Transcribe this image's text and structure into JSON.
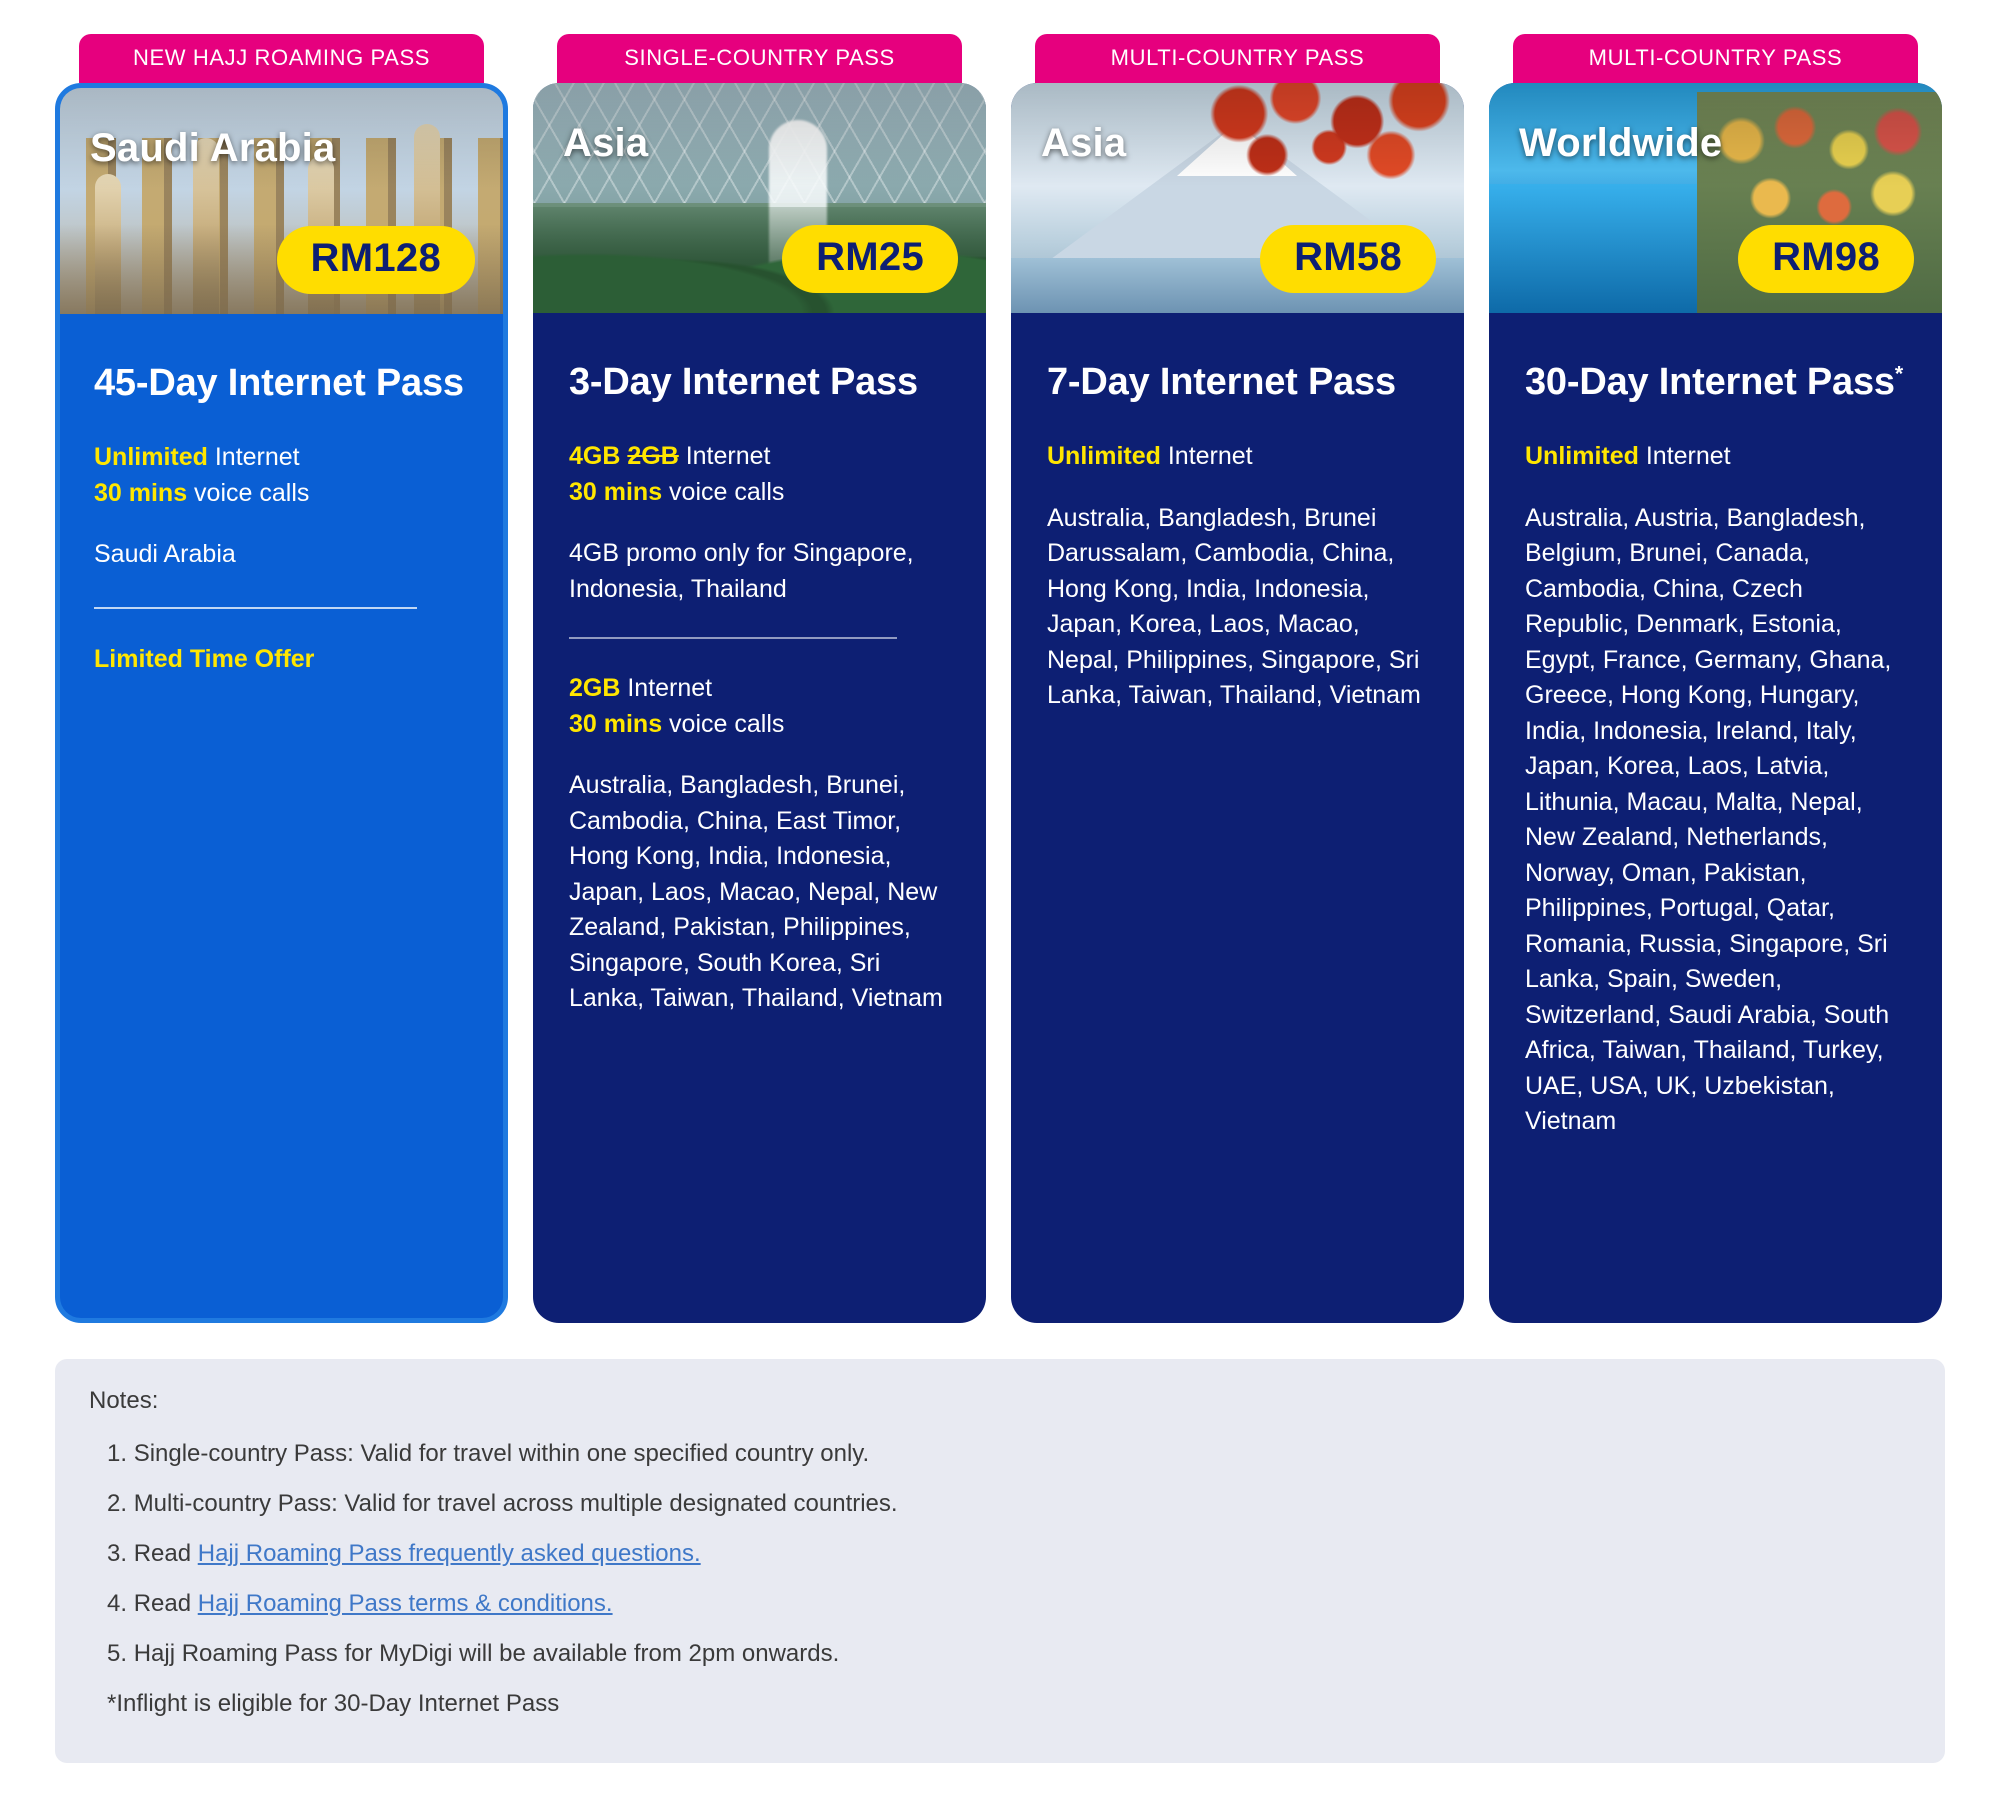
{
  "cards": [
    {
      "ribbon": "NEW HAJJ ROAMING PASS",
      "region": "Saudi Arabia",
      "price": "RM128",
      "plan_title": "45-Day Internet Pass",
      "spec_data_label": "Unlimited",
      "spec_data_rest": " Internet",
      "spec_voice_label": "30 mins",
      "spec_voice_rest": " voice calls",
      "countries": "Saudi Arabia",
      "offer": "Limited Time Offer",
      "art": "art-saudi"
    },
    {
      "ribbon": "SINGLE-COUNTRY PASS",
      "region": "Asia",
      "price": "RM25",
      "plan_title": "3-Day Internet Pass",
      "spec_data_label": "4GB",
      "spec_data_strike": "2GB",
      "spec_data_rest": " Internet",
      "spec_voice_label": "30 mins",
      "spec_voice_rest": " voice calls",
      "promo_note": "4GB promo only for Singapore, Indonesia, Thailand",
      "second_data_label": "2GB",
      "second_data_rest": " Internet",
      "second_voice_label": "30 mins",
      "second_voice_rest": " voice calls",
      "countries": "Australia, Bangladesh, Brunei, Cambodia, China, East Timor, Hong Kong, India, Indonesia, Japan, Laos, Macao, Nepal, New Zealand, Pakistan, Philippines, Singapore, South Korea, Sri Lanka, Taiwan, Thailand, Vietnam",
      "art": "art-jewel"
    },
    {
      "ribbon": "MULTI-COUNTRY PASS",
      "region": "Asia",
      "price": "RM58",
      "plan_title": "7-Day Internet Pass",
      "spec_data_label": "Unlimited",
      "spec_data_rest": " Internet",
      "countries": "Australia, Bangladesh, Brunei Darussalam, Cambodia, China, Hong Kong, India, Indonesia, Japan, Korea, Laos, Macao, Nepal, Philippines, Singapore, Sri Lanka, Taiwan, Thailand, Vietnam",
      "art": "art-fuji"
    },
    {
      "ribbon": "MULTI-COUNTRY PASS",
      "region": "Worldwide",
      "price": "RM98",
      "plan_title": "30-Day Internet Pass",
      "plan_title_sup": "*",
      "spec_data_label": "Unlimited",
      "spec_data_rest": " Internet",
      "countries": "Australia, Austria, Bangladesh, Belgium, Brunei, Canada, Cambodia, China, Czech Republic, Denmark, Estonia, Egypt, France, Germany, Ghana, Greece, Hong Kong, Hungary, India, Indonesia, Ireland, Italy, Japan, Korea, Laos, Latvia, Lithunia, Macau, Malta, Nepal, New Zealand, Netherlands, Norway, Oman, Pakistan, Philippines, Portugal, Qatar, Romania, Russia, Singapore, Sri Lanka, Spain, Sweden, Switzerland, Saudi Arabia, South Africa, Taiwan, Thailand, Turkey, UAE, USA, UK, Uzbekistan, Vietnam",
      "art": "art-world"
    }
  ],
  "notes": {
    "heading": "Notes:",
    "items": [
      {
        "num": "1.",
        "text": "Single-country Pass: Valid for travel within one specified country only."
      },
      {
        "num": "2.",
        "text": "Multi-country Pass: Valid for travel across multiple designated countries."
      },
      {
        "num": "3.",
        "prefix": "Read ",
        "link": "Hajj Roaming Pass frequently asked questions."
      },
      {
        "num": "4.",
        "prefix": "Read ",
        "link": "Hajj Roaming Pass terms & conditions."
      },
      {
        "num": "5.",
        "text": "Hajj Roaming Pass for MyDigi will be available from 2pm onwards."
      },
      {
        "num": "",
        "text": "*Inflight is eligible for 30-Day Internet Pass"
      }
    ]
  },
  "colors": {
    "ribbon_pink": "#e6007e",
    "card_navy": "#0d1f73",
    "card_featured_blue": "#0a5fd4",
    "price_yellow": "#ffdd00",
    "highlight_yellow": "#ffe600",
    "notes_bg": "#e8eaf2",
    "link_blue": "#3f78c8"
  }
}
